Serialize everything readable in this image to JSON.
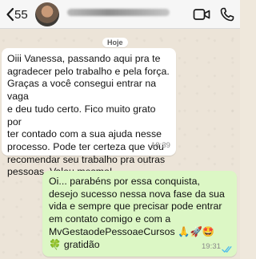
{
  "header": {
    "back_icon": "chevron-left-icon",
    "unread_count": "55",
    "contact_name": "",
    "video_icon": "video-camera-icon",
    "phone_icon": "phone-icon"
  },
  "date_divider": "Hoje",
  "messages": [
    {
      "direction": "incoming",
      "text": "Oiii Vanessa, passando aqui pra te\nagradecer pelo trabalho e pela força.\nGraças a você consegui entrar na vaga\ne deu tudo certo. Fico muito grato por\nter contado com a sua ajuda nesse\nprocesso. Pode ter certeza que vou\nrecomendar seu trabalho pra outras\npessoas. Valeu mesmo!",
      "time": "18:39"
    },
    {
      "direction": "outgoing",
      "text": "Oi... parabéns por essa conquista,\ndesejo sucesso nessa nova fase da sua\nvida e sempre que precisar pode entrar\nem contato comigo e com a\nMvGestaodePessoaeCursos 🙏🚀🤩\n🍀 gratidão",
      "time": "19:31",
      "status": "read",
      "tick_color": "#53bdeb"
    }
  ],
  "colors": {
    "incoming_bubble": "#ffffff",
    "outgoing_bubble": "#dcf7c5",
    "accent": "#007aff"
  }
}
